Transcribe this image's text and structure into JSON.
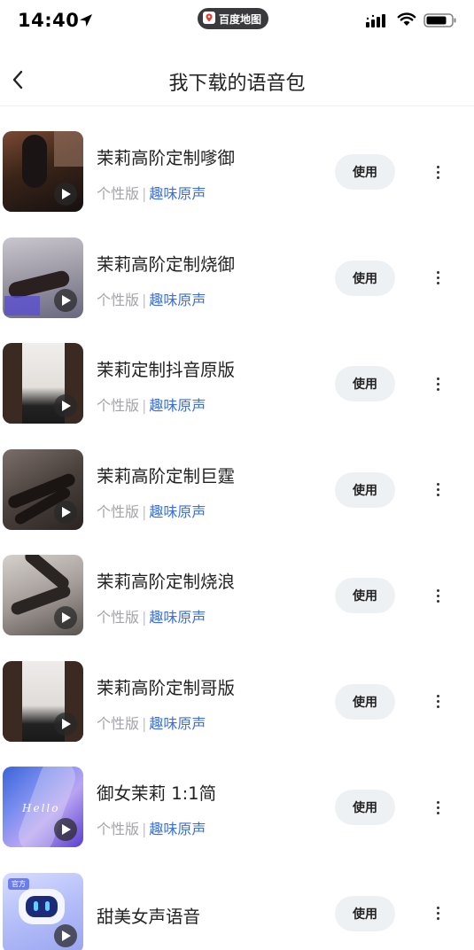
{
  "status_bar": {
    "time": "14:40",
    "app_pill": "百度地图"
  },
  "header": {
    "title": "我下载的语音包",
    "back_icon": "chevron-left-icon"
  },
  "colors": {
    "accent": "#3e6fd8",
    "muted": "#a4a4a8",
    "button_bg": "#eef1f4"
  },
  "voices": [
    {
      "name": "茉莉高阶定制嗲御",
      "edition": "个性版",
      "separator": "|",
      "category": "趣味原声",
      "use_label": "使用"
    },
    {
      "name": "茉莉高阶定制烧御",
      "edition": "个性版",
      "separator": "|",
      "category": "趣味原声",
      "use_label": "使用"
    },
    {
      "name": "茉莉定制抖音原版",
      "edition": "个性版",
      "separator": "|",
      "category": "趣味原声",
      "use_label": "使用"
    },
    {
      "name": "茉莉高阶定制巨霆",
      "edition": "个性版",
      "separator": "|",
      "category": "趣味原声",
      "use_label": "使用"
    },
    {
      "name": "茉莉高阶定制烧浪",
      "edition": "个性版",
      "separator": "|",
      "category": "趣味原声",
      "use_label": "使用"
    },
    {
      "name": "茉莉高阶定制哥版",
      "edition": "个性版",
      "separator": "|",
      "category": "趣味原声",
      "use_label": "使用"
    },
    {
      "name": "御女茉莉 1:1简",
      "edition": "个性版",
      "separator": "|",
      "category": "趣味原声",
      "use_label": "使用",
      "thumb_text": "Hello"
    },
    {
      "name": "甜美女声语音",
      "use_label": "使用",
      "thumb_badge": "官方"
    }
  ]
}
